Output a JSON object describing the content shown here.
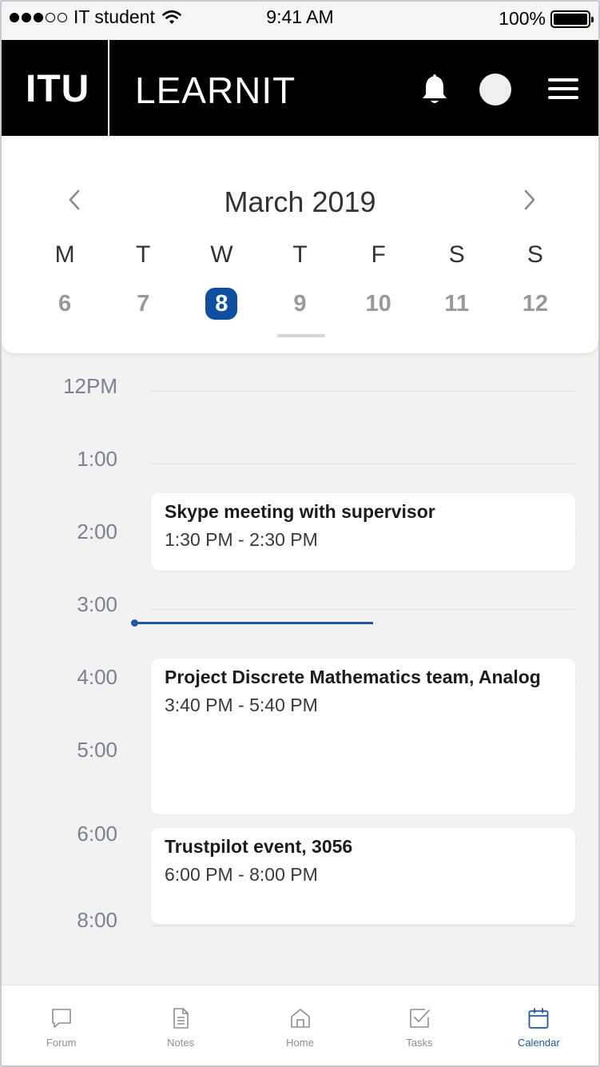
{
  "status_bar": {
    "carrier": "IT student",
    "time": "9:41 AM",
    "battery": "100%"
  },
  "header": {
    "logo": "ITU",
    "app_name": "LEARNIT",
    "icons": [
      "bell-icon",
      "avatar",
      "menu-icon"
    ]
  },
  "calendar": {
    "month": "March 2019",
    "weekdays": [
      "M",
      "T",
      "W",
      "T",
      "F",
      "S",
      "S"
    ],
    "days": [
      "6",
      "7",
      "8",
      "9",
      "10",
      "11",
      "12"
    ],
    "selected_day": "8"
  },
  "timeline": {
    "hours": [
      "12PM",
      "1:00",
      "2:00",
      "3:00",
      "4:00",
      "5:00",
      "6:00",
      "8:00"
    ],
    "events": [
      {
        "title": "Skype meeting with supervisor",
        "time": "1:30 PM - 2:30 PM"
      },
      {
        "title": "Project Discrete Mathematics team, Analog",
        "time": "3:40 PM - 5:40 PM"
      },
      {
        "title": "Trustpilot event, 3056",
        "time": "6:00 PM - 8:00 PM"
      }
    ]
  },
  "tabs": [
    {
      "label": "Forum",
      "icon": "chat-icon"
    },
    {
      "label": "Notes",
      "icon": "document-icon"
    },
    {
      "label": "Home",
      "icon": "home-icon"
    },
    {
      "label": "Tasks",
      "icon": "checkbox-icon"
    },
    {
      "label": "Calendar",
      "icon": "calendar-icon"
    }
  ],
  "active_tab": "Calendar",
  "colors": {
    "accent": "#1f58a5",
    "header_bg": "#000000",
    "selected_day_bg": "#0d4fa0"
  }
}
